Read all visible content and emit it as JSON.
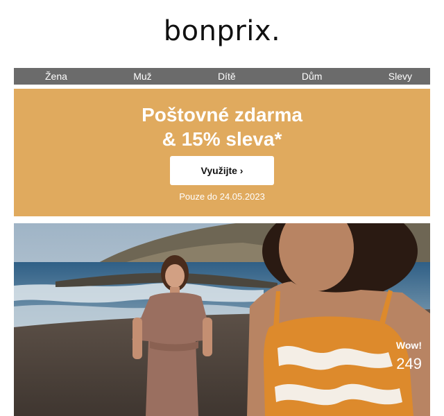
{
  "brand": {
    "logo_text": "bonprix."
  },
  "nav": {
    "items": [
      {
        "label": "Žena"
      },
      {
        "label": "Muž"
      },
      {
        "label": "Dítě"
      },
      {
        "label": "Dům"
      },
      {
        "label": "Slevy"
      }
    ]
  },
  "promo": {
    "headline_line1": "Poštovné zdarma",
    "headline_line2": "& 15% sleva*",
    "cta_label": "Využijte ›",
    "note": "Pouze do 24.05.2023",
    "bg_color": "#e0aa5e"
  },
  "hero": {
    "badge": "Wow!",
    "price": "249"
  },
  "colors": {
    "nav_bg": "#6b6b6b",
    "accent": "#e0aa5e"
  }
}
